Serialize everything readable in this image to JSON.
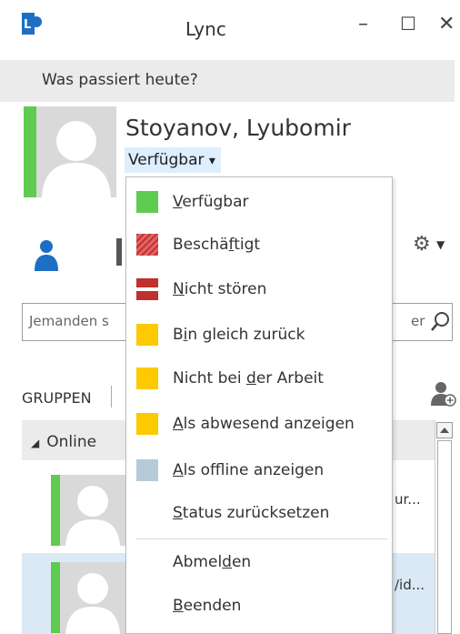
{
  "window": {
    "title": "Lync",
    "minimize": "–",
    "maximize": "☐",
    "close": "✕"
  },
  "mood": {
    "text": "Was passiert heute?"
  },
  "profile": {
    "name": "Stoyanov, Lyubomir",
    "status": "Verfügbar",
    "status_caret": "▾"
  },
  "search": {
    "placeholder_start": "Jemanden s",
    "placeholder_end": "er"
  },
  "groups": {
    "label": "GRUPPEN"
  },
  "list": {
    "group_name": "Online",
    "expand_glyph": "◢",
    "contact1_tail": "ur...",
    "contact2_tail": "/id..."
  },
  "colors": {
    "available": "#5fcb50",
    "busy": "#d23c3c",
    "dnd": "#c0302f",
    "away": "#fdc900",
    "offline": "#b5ccd8",
    "status_highlight": "#ddeefd"
  },
  "status_menu": {
    "items": [
      {
        "pre": "",
        "ul": "V",
        "post": "erfügbar",
        "icon": "available-icon"
      },
      {
        "pre": "Beschä",
        "ul": "f",
        "post": "tigt",
        "icon": "busy-icon"
      },
      {
        "pre": "",
        "ul": "N",
        "post": "icht stören",
        "icon": "do-not-disturb-icon"
      },
      {
        "pre": "B",
        "ul": "i",
        "post": "n gleich zurück",
        "icon": "be-right-back-icon"
      },
      {
        "pre": "Nicht bei ",
        "ul": "d",
        "post": "er Arbeit",
        "icon": "off-work-icon"
      },
      {
        "pre": "",
        "ul": "A",
        "post": "ls abwesend anzeigen",
        "icon": "appear-away-icon"
      },
      {
        "pre": "",
        "ul": "A",
        "post": "ls offline anzeigen",
        "icon": "appear-offline-icon"
      },
      {
        "pre": "",
        "ul": "S",
        "post": "tatus zurücksetzen",
        "icon": ""
      },
      {
        "pre": "Abmel",
        "ul": "d",
        "post": "en",
        "icon": ""
      },
      {
        "pre": "",
        "ul": "B",
        "post": "eenden",
        "icon": ""
      }
    ]
  }
}
